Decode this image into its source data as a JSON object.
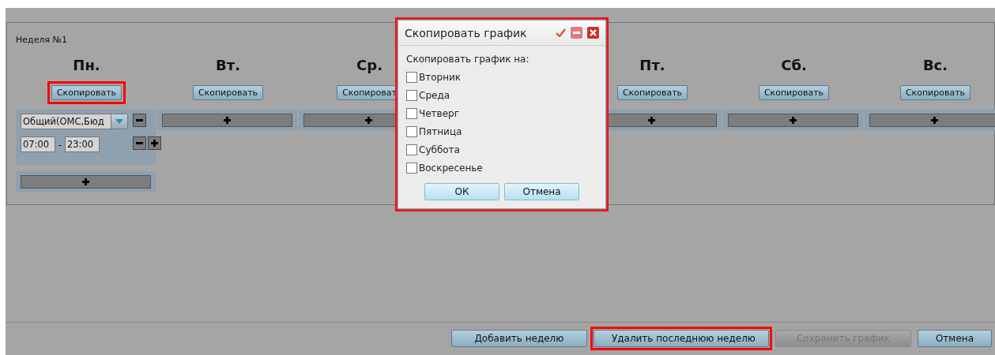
{
  "week": {
    "title": "Неделя №1",
    "days": [
      {
        "label": "Пн.",
        "copy_button": {
          "label": "Скопировать",
          "highlighted": true
        },
        "entries": [
          {
            "type": "Общий(ОМС,Бюд",
            "start": "07:00",
            "separator": "-",
            "end": "23:00"
          }
        ]
      },
      {
        "label": "Вт.",
        "copy_button": {
          "label": "Скопировать",
          "highlighted": false
        }
      },
      {
        "label": "Ср.",
        "copy_button": {
          "label": "Скопироват",
          "highlighted": false
        }
      },
      {
        "label": "Пт.",
        "copy_button": {
          "label": "Скопировать",
          "highlighted": false
        }
      },
      {
        "label": "Сб.",
        "copy_button": {
          "label": "Скопировать",
          "highlighted": false
        }
      },
      {
        "label": "Вс.",
        "copy_button": {
          "label": "Скопировать",
          "highlighted": false
        }
      }
    ]
  },
  "dialog": {
    "title": "Скопировать график",
    "highlighted": true,
    "prompt": "Скопировать график на:",
    "options": [
      {
        "label": "Вторник",
        "checked": false
      },
      {
        "label": "Среда",
        "checked": false
      },
      {
        "label": "Четверг",
        "checked": false
      },
      {
        "label": "Пятница",
        "checked": false
      },
      {
        "label": "Суббота",
        "checked": false
      },
      {
        "label": "Воскресенье",
        "checked": false
      }
    ],
    "buttons": [
      "ОК",
      "Отмена"
    ]
  },
  "footer": {
    "buttons": [
      {
        "label": "Добавить неделю",
        "disabled": false,
        "highlighted": false
      },
      {
        "label": "Удалить последнюю неделю",
        "disabled": false,
        "highlighted": true
      },
      {
        "label": "Сохранить график",
        "disabled": true,
        "highlighted": false
      },
      {
        "label": "Отмена",
        "disabled": false,
        "highlighted": false
      }
    ]
  }
}
